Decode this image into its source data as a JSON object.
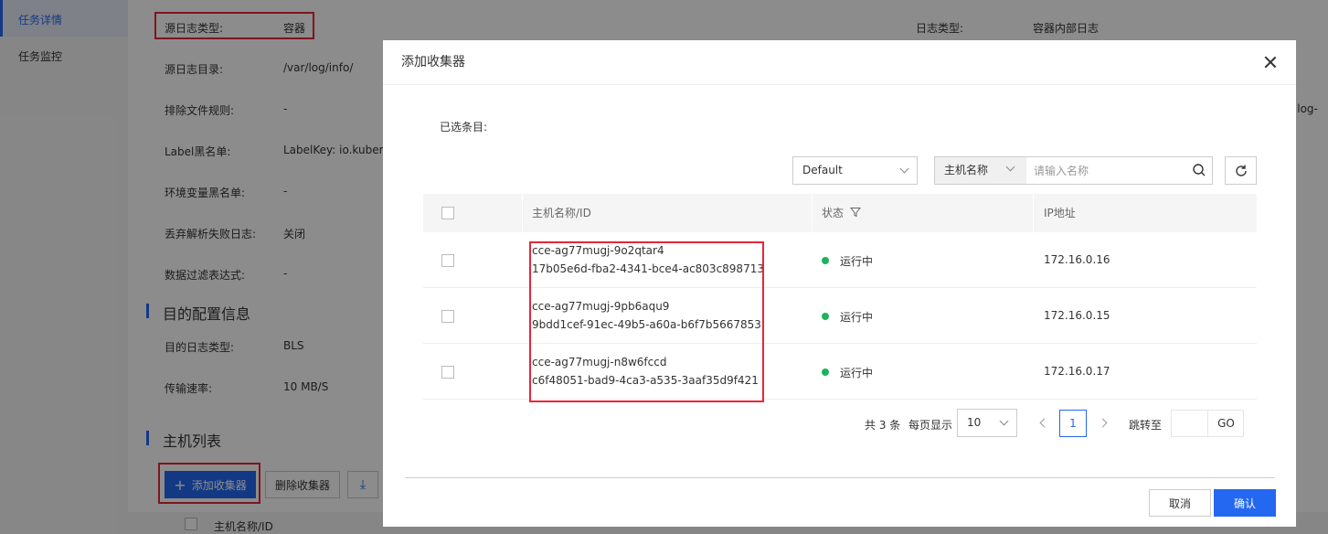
{
  "nav": {
    "items": [
      {
        "label": "任务详情"
      },
      {
        "label": "任务监控"
      }
    ]
  },
  "details": {
    "source_type_label": "源日志类型:",
    "source_type_value": "容器",
    "log_type_label": "日志类型:",
    "log_type_value": "容器内部日志",
    "source_dir_label": "源日志目录:",
    "source_dir_value": "/var/log/info/",
    "exclude_label": "排除文件规则:",
    "exclude_value": "-",
    "label_blacklist_label": "Label黑名单:",
    "label_blacklist_value": "LabelKey: io.kuberr",
    "env_blacklist_label": "环境变量黑名单:",
    "env_blacklist_value": "-",
    "discard_label": "丢弃解析失败日志:",
    "discard_value": "关闭",
    "filter_label": "数据过滤表达式:",
    "filter_value": "-",
    "right_peek": "e: log-",
    "dest_section": "目的配置信息",
    "dest_type_label": "目的日志类型:",
    "dest_type_value": "BLS",
    "rate_label": "传输速率:",
    "rate_value": "10 MB/S",
    "host_section": "主机列表",
    "add_collector": "添加收集器",
    "delete_collector": "删除收集器",
    "bg_col_host": "主机名称/ID"
  },
  "dialog": {
    "title": "添加收集器",
    "selected_label": "已选条目:",
    "region_select": "Default",
    "search_type": "主机名称",
    "search_placeholder": "请输入名称",
    "columns": {
      "host": "主机名称/ID",
      "status": "状态",
      "ip": "IP地址"
    },
    "rows": [
      {
        "name": "cce-ag77mugj-9o2qtar4",
        "id": "17b05e6d-fba2-4341-bce4-ac803c898713",
        "status": "运行中",
        "ip": "172.16.0.16"
      },
      {
        "name": "cce-ag77mugj-9pb6aqu9",
        "id": "9bdd1cef-91ec-49b5-a60a-b6f7b5667853",
        "status": "运行中",
        "ip": "172.16.0.15"
      },
      {
        "name": "cce-ag77mugj-n8w6fccd",
        "id": "c6f48051-bad9-4ca3-a535-3aaf35d9f421",
        "status": "运行中",
        "ip": "172.16.0.17"
      }
    ],
    "pager": {
      "total": "共 3 条",
      "per_page_label": "每页显示",
      "per_page": "10",
      "current_page": "1",
      "jump_label": "跳转至",
      "go": "GO"
    },
    "cancel": "取消",
    "confirm": "确认"
  },
  "colors": {
    "accent": "#2468f2",
    "highlight": "#e4273b",
    "status_running": "#1bb35f"
  }
}
